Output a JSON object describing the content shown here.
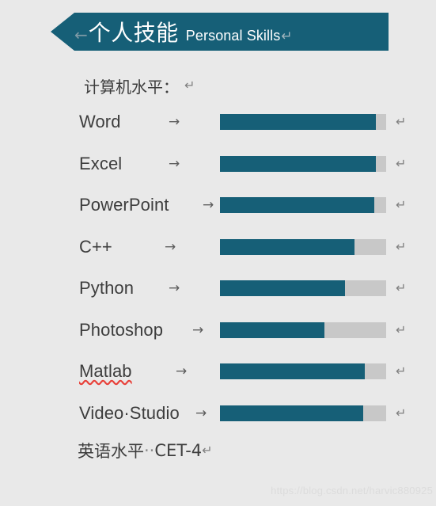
{
  "colors": {
    "page_background": "#e9e9e9",
    "accent_teal": "#165f77",
    "bar_track_gray": "#c8c8c8",
    "text_dark": "#3d3d3d",
    "spellcheck_red": "#e8413a",
    "mark_gray": "#808080"
  },
  "banner": {
    "pre_mark": "←",
    "title_cn": "个人技能",
    "title_en": "Personal Skills",
    "post_mark": "↵"
  },
  "section": {
    "label": "计算机水平：",
    "return_mark": "↵"
  },
  "marks": {
    "tab_arrow": "→",
    "return": "↵",
    "space_dot": "·"
  },
  "skills": [
    {
      "name": "Word",
      "percent": 94,
      "misspelled": false,
      "arrow": "→",
      "return_mark": "↵"
    },
    {
      "name": "Excel",
      "percent": 94,
      "misspelled": false,
      "arrow": "→",
      "return_mark": "↵"
    },
    {
      "name": "PowerPoint",
      "percent": 93,
      "misspelled": false,
      "arrow": "→",
      "return_mark": "↵"
    },
    {
      "name": "C++",
      "percent": 81,
      "misspelled": false,
      "arrow": "→",
      "return_mark": "↵"
    },
    {
      "name": "Python",
      "percent": 75,
      "misspelled": false,
      "arrow": "→",
      "return_mark": "↵"
    },
    {
      "name": "Photoshop",
      "percent": 63,
      "misspelled": false,
      "arrow": "→",
      "return_mark": "↵"
    },
    {
      "name": "Matlab",
      "percent": 87,
      "misspelled": true,
      "arrow": "→",
      "return_mark": "↵"
    },
    {
      "name": "Video·Studio",
      "percent": 86,
      "misspelled": false,
      "arrow": "→",
      "return_mark": "↵"
    }
  ],
  "footer": {
    "label": "英语水平",
    "space_dots": "··",
    "value": "CET-4",
    "return_mark": "↵"
  },
  "watermark": {
    "text": "https://blog.csdn.net/harvic880925"
  }
}
